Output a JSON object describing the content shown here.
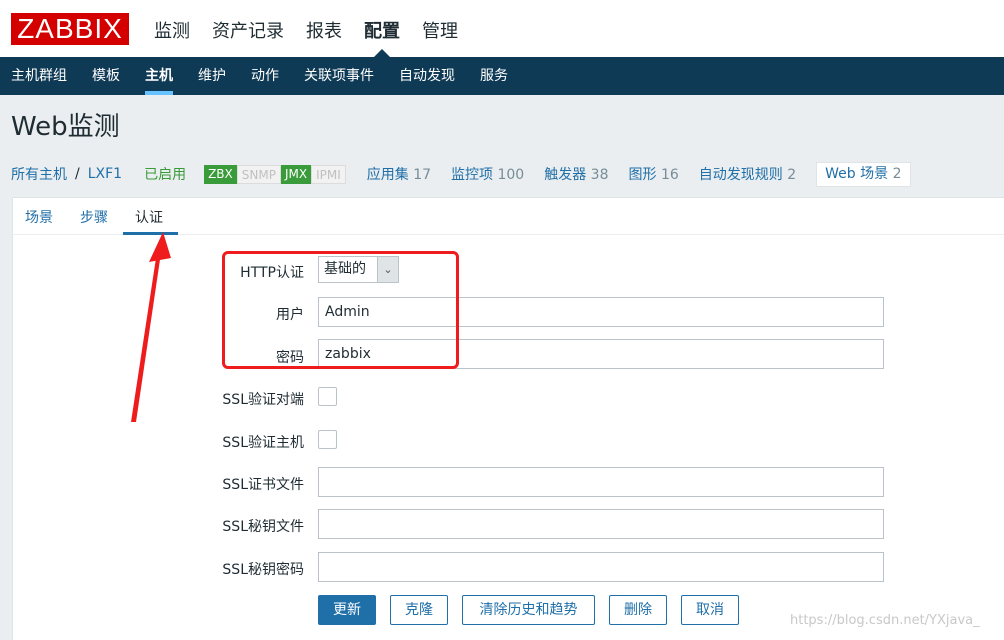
{
  "logo": "ZABBIX",
  "main_nav": [
    "监测",
    "资产记录",
    "报表",
    "配置",
    "管理"
  ],
  "sub_nav": [
    "主机群组",
    "模板",
    "主机",
    "维护",
    "动作",
    "关联项事件",
    "自动发现",
    "服务"
  ],
  "page_title": "Web监测",
  "breadcrumb": {
    "all_hosts": "所有主机",
    "separator": "/",
    "host": "LXF1",
    "status": "已启用",
    "availability": [
      "ZBX",
      "SNMP",
      "JMX",
      "IPMI"
    ],
    "stats": [
      {
        "label": "应用集",
        "count": "17"
      },
      {
        "label": "监控项",
        "count": "100"
      },
      {
        "label": "触发器",
        "count": "38"
      },
      {
        "label": "图形",
        "count": "16"
      },
      {
        "label": "自动发现规则",
        "count": "2"
      }
    ],
    "current": {
      "label": "Web 场景",
      "count": "2"
    }
  },
  "tabs": [
    "场景",
    "步骤",
    "认证"
  ],
  "form": {
    "http_auth_label": "HTTP认证",
    "http_auth_value": "基础的",
    "user_label": "用户",
    "user_value": "Admin",
    "password_label": "密码",
    "password_value": "zabbix",
    "ssl_verify_peer_label": "SSL验证对端",
    "ssl_verify_host_label": "SSL验证主机",
    "ssl_cert_label": "SSL证书文件",
    "ssl_key_label": "SSL秘钥文件",
    "ssl_key_password_label": "SSL秘钥密码"
  },
  "buttons": [
    "更新",
    "克隆",
    "清除历史和趋势",
    "删除",
    "取消"
  ],
  "watermark": "https://blog.csdn.net/YXjava_",
  "colors": {
    "brand": "#d40000",
    "nav": "#0e3a55",
    "link": "#1f6fa8",
    "enabled": "#3a9b3a",
    "annotation": "#ee1c1c"
  }
}
